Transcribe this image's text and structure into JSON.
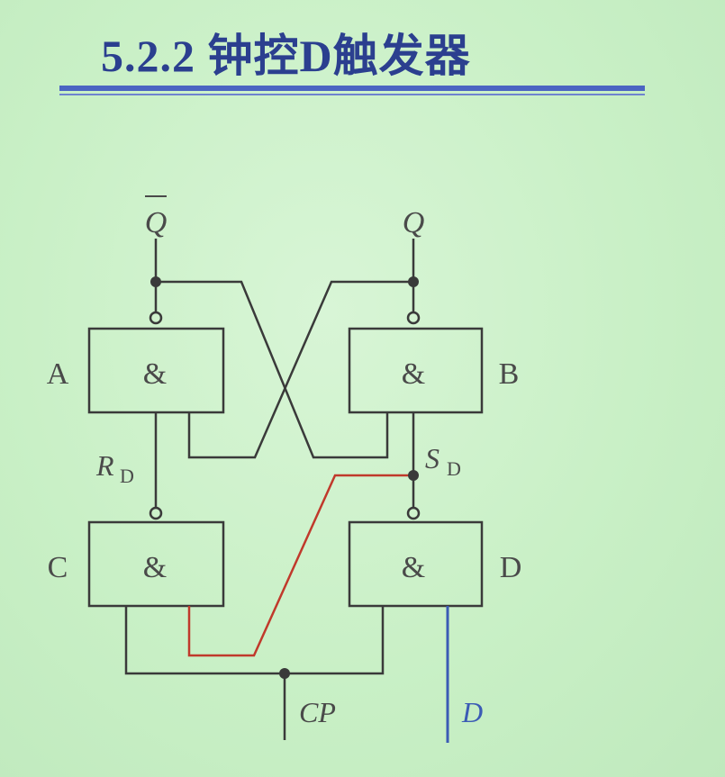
{
  "title": "5.2.2 钟控D触发器",
  "colors": {
    "title": "#2b3f8f",
    "rule": "#4b64c2",
    "wire": "#3a3a3a",
    "feedback_wire": "#c0392b",
    "d_input_wire": "#3b5bb5",
    "background": "#c9f0c6"
  },
  "diagram": {
    "outputs": {
      "q_bar": "Q",
      "q": "Q"
    },
    "gates": {
      "a": {
        "name": "A",
        "symbol": "&"
      },
      "b": {
        "name": "B",
        "symbol": "&"
      },
      "c": {
        "name": "C",
        "symbol": "&"
      },
      "d": {
        "name": "D",
        "symbol": "&"
      }
    },
    "signals": {
      "rd": {
        "main": "R",
        "sub": "D"
      },
      "sd": {
        "main": "S",
        "sub": "D"
      },
      "cp": "CP",
      "d_input": "D"
    }
  }
}
